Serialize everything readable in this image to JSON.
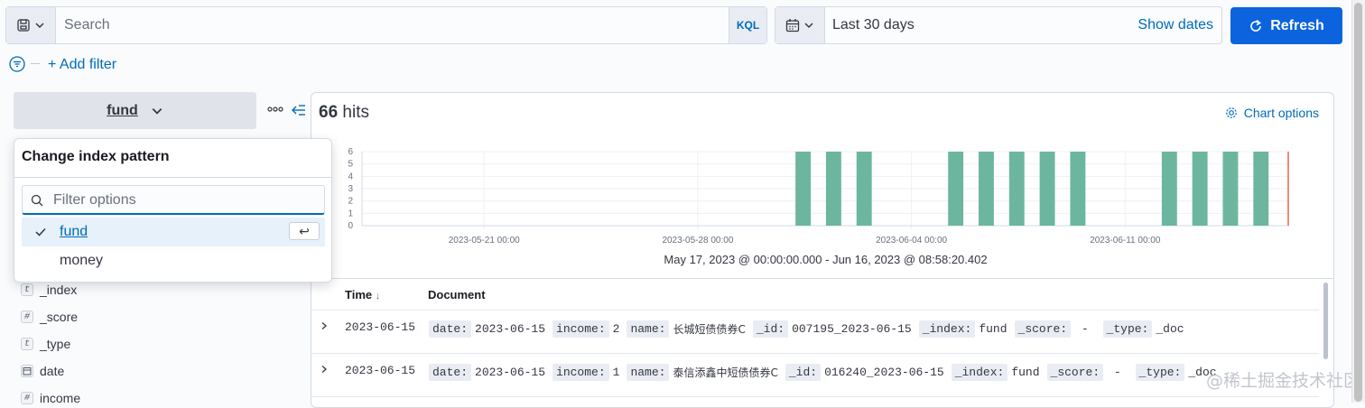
{
  "query_bar": {
    "search_placeholder": "Search",
    "language": "KQL"
  },
  "date_picker": {
    "range_label": "Last 30 days",
    "show_dates_label": "Show dates"
  },
  "refresh_label": "Refresh",
  "add_filter_label": "+ Add filter",
  "sidebar": {
    "index_pattern": "fund",
    "fields": [
      {
        "type_token": "t",
        "name": "_index"
      },
      {
        "type_token": "#",
        "name": "_score"
      },
      {
        "type_token": "t",
        "name": "_type"
      },
      {
        "type_token": "date",
        "name": "date"
      },
      {
        "type_token": "#",
        "name": "income"
      }
    ]
  },
  "popover": {
    "title": "Change index pattern",
    "filter_placeholder": "Filter options",
    "options": [
      {
        "label": "fund",
        "selected": true,
        "key_hint": "↩"
      },
      {
        "label": "money",
        "selected": false
      }
    ]
  },
  "hits": {
    "count": "66",
    "label": "hits"
  },
  "chart_options_label": "Chart options",
  "chart_data": {
    "type": "bar",
    "x_tick_labels": [
      "2023-05-21 00:00",
      "2023-05-28 00:00",
      "2023-06-04 00:00",
      "2023-06-11 00:00"
    ],
    "y_tick_labels": [
      "0",
      "1",
      "2",
      "3",
      "4",
      "5",
      "6"
    ],
    "ylim": [
      0,
      6
    ],
    "x_start": "2023-05-17",
    "x_end": "2023-06-16",
    "dates": [
      "2023-05-31",
      "2023-06-01",
      "2023-06-02",
      "2023-06-05",
      "2023-06-06",
      "2023-06-07",
      "2023-06-08",
      "2023-06-09",
      "2023-06-12",
      "2023-06-13",
      "2023-06-14",
      "2023-06-15"
    ],
    "values": [
      6,
      6,
      6,
      6,
      6,
      6,
      6,
      6,
      6,
      6,
      6,
      6
    ],
    "bar_color": "#6cb6a0",
    "now_marker_color": "#e7664c",
    "grid": true
  },
  "time_range_caption": "May 17, 2023 @ 00:00:00.000 - Jun 16, 2023 @ 08:58:20.402",
  "table": {
    "col_time": "Time",
    "col_document": "Document",
    "rows": [
      {
        "time": "2023-06-15",
        "fields": [
          {
            "k": "date:",
            "v": "2023-06-15"
          },
          {
            "k": "income:",
            "v": "2"
          },
          {
            "k": "name:",
            "v": "长城短债债券C"
          },
          {
            "k": "_id:",
            "v": "007195_2023-06-15"
          },
          {
            "k": "_index:",
            "v": "fund"
          },
          {
            "k": "_score:",
            "v": " - "
          },
          {
            "k": "_type:",
            "v": "_doc"
          }
        ]
      },
      {
        "time": "2023-06-15",
        "fields": [
          {
            "k": "date:",
            "v": "2023-06-15"
          },
          {
            "k": "income:",
            "v": "1"
          },
          {
            "k": "name:",
            "v": "泰信添鑫中短债债券C"
          },
          {
            "k": "_id:",
            "v": "016240_2023-06-15"
          },
          {
            "k": "_index:",
            "v": "fund"
          },
          {
            "k": "_score:",
            "v": " - "
          },
          {
            "k": "_type:",
            "v": "_doc"
          }
        ]
      }
    ]
  },
  "watermark": "@稀土掘金技术社区"
}
